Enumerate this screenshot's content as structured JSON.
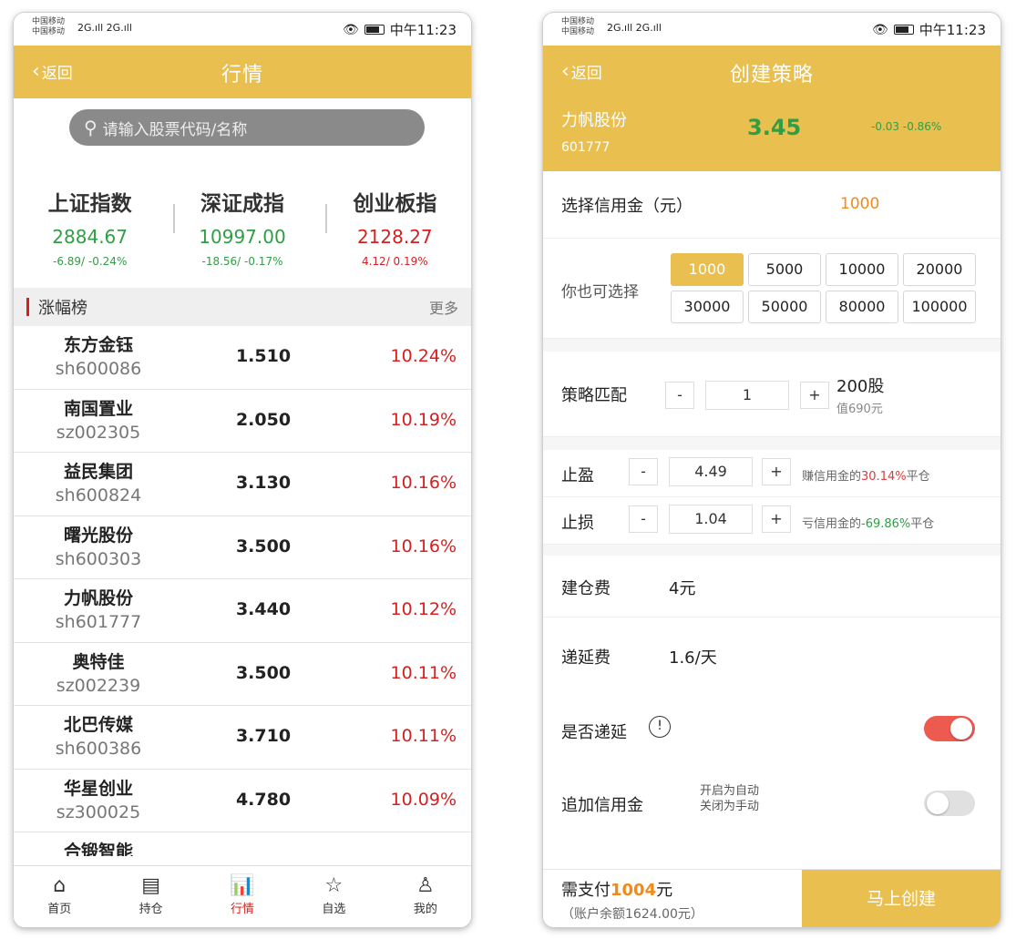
{
  "status": {
    "carrier1": "中国移动",
    "carrier2": "中国移动",
    "signal": "2G.ıll 2G.ıll",
    "time": "中午11:23"
  },
  "left": {
    "nav": {
      "back": "返回",
      "title": "行情"
    },
    "search_placeholder": "请输入股票代码/名称",
    "indices": [
      {
        "name": "上证指数",
        "value": "2884.67",
        "change": "-6.89/ -0.24%",
        "dir": "down"
      },
      {
        "name": "深证成指",
        "value": "10997.00",
        "change": "-18.56/ -0.17%",
        "dir": "down"
      },
      {
        "name": "创业板指",
        "value": "2128.27",
        "change": "4.12/ 0.19%",
        "dir": "up"
      }
    ],
    "section": {
      "title": "涨幅榜",
      "more": "更多"
    },
    "stocks": [
      {
        "name": "东方金钰",
        "code": "sh600086",
        "price": "1.510",
        "pct": "10.24%"
      },
      {
        "name": "南国置业",
        "code": "sz002305",
        "price": "2.050",
        "pct": "10.19%"
      },
      {
        "name": "益民集团",
        "code": "sh600824",
        "price": "3.130",
        "pct": "10.16%"
      },
      {
        "name": "曙光股份",
        "code": "sh600303",
        "price": "3.500",
        "pct": "10.16%"
      },
      {
        "name": "力帆股份",
        "code": "sh601777",
        "price": "3.440",
        "pct": "10.12%"
      },
      {
        "name": "奥特佳",
        "code": "sz002239",
        "price": "3.500",
        "pct": "10.11%"
      },
      {
        "name": "北巴传媒",
        "code": "sh600386",
        "price": "3.710",
        "pct": "10.11%"
      },
      {
        "name": "华星创业",
        "code": "sz300025",
        "price": "4.780",
        "pct": "10.09%"
      },
      {
        "name": "合锻智能",
        "code": "",
        "price": "",
        "pct": ""
      }
    ],
    "tabs": [
      {
        "label": "首页",
        "icon": "home-icon",
        "glyph": "⌂"
      },
      {
        "label": "持仓",
        "icon": "holdings-icon",
        "glyph": "▤"
      },
      {
        "label": "行情",
        "icon": "market-chart-icon",
        "glyph": "📊"
      },
      {
        "label": "自选",
        "icon": "favorite-icon",
        "glyph": "☆"
      },
      {
        "label": "我的",
        "icon": "user-icon",
        "glyph": "♙"
      }
    ]
  },
  "right": {
    "nav": {
      "back": "返回",
      "title": "创建策略"
    },
    "stock": {
      "name": "力帆股份",
      "code": "601777",
      "price": "3.45",
      "change": "-0.03  -0.86%"
    },
    "credit": {
      "label": "选择信用金（元）",
      "value": "1000"
    },
    "options": {
      "label": "你也可选择",
      "values": [
        "1000",
        "5000",
        "10000",
        "20000",
        "30000",
        "50000",
        "80000",
        "100000"
      ],
      "selected": "1000"
    },
    "match": {
      "label": "策略匹配",
      "minus": "-",
      "value": "1",
      "plus": "+",
      "shares": "200股",
      "worth": "值690元"
    },
    "take_profit": {
      "label": "止盈",
      "minus": "-",
      "value": "4.49",
      "plus": "+",
      "desc_pre": "赚信用金的",
      "desc_pct": "30.14%",
      "desc_post": "平仓"
    },
    "stop_loss": {
      "label": "止损",
      "minus": "-",
      "value": "1.04",
      "plus": "+",
      "desc_pre": "亏信用金的",
      "desc_pct": "-69.86%",
      "desc_post": "平仓"
    },
    "open_fee": {
      "label": "建仓费",
      "value": "4元"
    },
    "defer_fee": {
      "label": "递延费",
      "value": "1.6/天"
    },
    "defer": {
      "label": "是否递延",
      "info_glyph": "!",
      "on": true
    },
    "add_credit": {
      "label": "追加信用金",
      "note1": "开启为自动",
      "note2": "关闭为手动",
      "on": false
    },
    "footer": {
      "pay_pre": "需支付",
      "pay_amt": "1004",
      "pay_post": "元",
      "balance": "（账户余额1624.00元）",
      "button": "马上创建"
    }
  },
  "colors": {
    "brand": "#e9bf50",
    "up": "#d61f1f",
    "down": "#2f9e44",
    "toggle_on": "#ec5a50"
  }
}
